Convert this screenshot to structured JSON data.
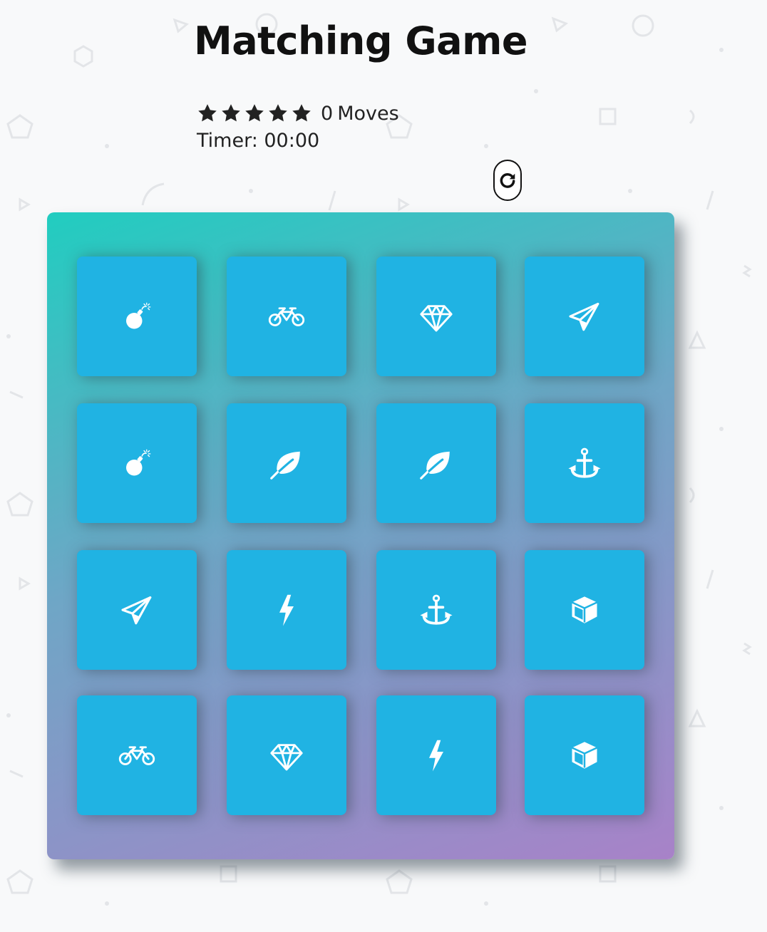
{
  "header": {
    "title": "Matching Game"
  },
  "score_panel": {
    "star_count": 5,
    "star_icon": "star-icon",
    "moves_count": "0",
    "moves_label": "Moves",
    "timer_text": "Timer: 00:00"
  },
  "restart": {
    "icon": "repeat-icon"
  },
  "colors": {
    "card": "#20b3e3",
    "icon": "#ffffff",
    "deck_gradient_start": "#21cdc0",
    "deck_gradient_end": "#a882c8",
    "background": "#f8f9fa"
  },
  "deck": {
    "cards": [
      {
        "icon": "bomb-icon"
      },
      {
        "icon": "bicycle-icon"
      },
      {
        "icon": "diamond-icon"
      },
      {
        "icon": "paper-plane-icon"
      },
      {
        "icon": "bomb-icon"
      },
      {
        "icon": "leaf-icon"
      },
      {
        "icon": "leaf-icon"
      },
      {
        "icon": "anchor-icon"
      },
      {
        "icon": "paper-plane-icon"
      },
      {
        "icon": "bolt-icon"
      },
      {
        "icon": "anchor-icon"
      },
      {
        "icon": "cube-icon"
      },
      {
        "icon": "bicycle-icon"
      },
      {
        "icon": "diamond-icon"
      },
      {
        "icon": "bolt-icon"
      },
      {
        "icon": "cube-icon"
      }
    ]
  }
}
